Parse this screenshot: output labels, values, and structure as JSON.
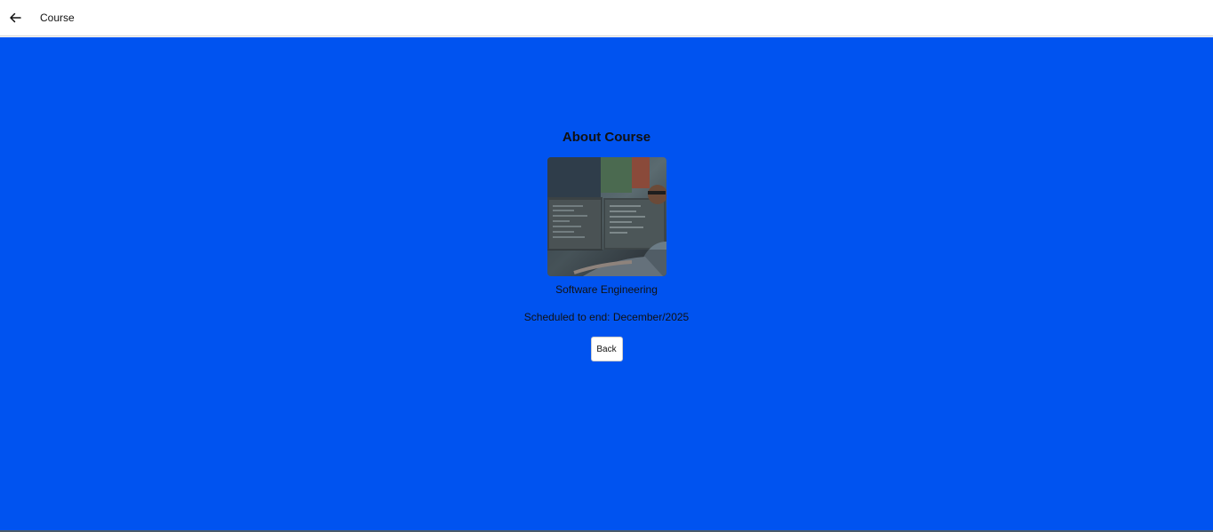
{
  "header": {
    "back_icon": "arrow-left-icon",
    "title": "Course"
  },
  "main": {
    "background_color": "#0053f0",
    "heading": "About Course",
    "course_name": "Software Engineering",
    "schedule_text": "Scheduled to end: December/2025",
    "back_button_label": "Back"
  }
}
